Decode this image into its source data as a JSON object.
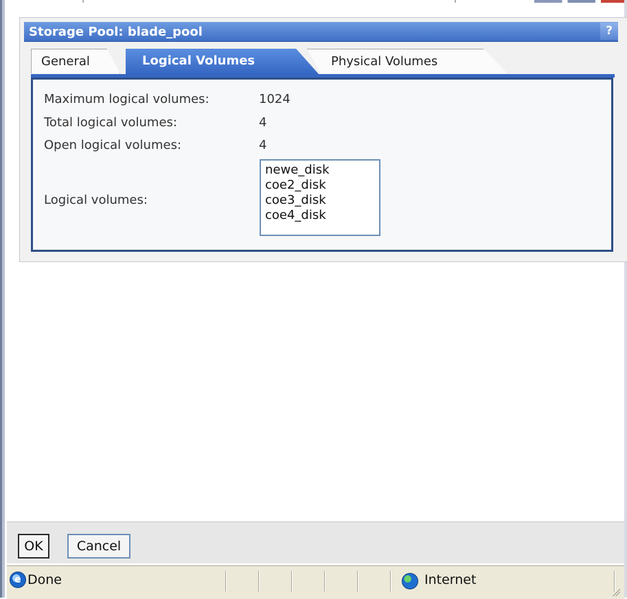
{
  "dialog": {
    "title": "Storage Pool: blade_pool",
    "help_label": "?"
  },
  "tabs": [
    {
      "label": "General"
    },
    {
      "label": "Logical Volumes"
    },
    {
      "label": "Physical Volumes"
    }
  ],
  "fields": {
    "max_label": "Maximum logical volumes:",
    "max_value": "1024",
    "total_label": "Total logical volumes:",
    "total_value": "4",
    "open_label": "Open logical volumes:",
    "open_value": "4",
    "list_label": "Logical volumes:",
    "list_items": [
      "newe_disk",
      "coe2_disk",
      "coe3_disk",
      "coe4_disk"
    ]
  },
  "buttons": {
    "ok": "OK",
    "cancel": "Cancel"
  },
  "status": {
    "done": "Done",
    "zone": "Internet"
  },
  "colors": {
    "titlebar": "#3f6fc6",
    "active_tab": "#3566c2",
    "panel_border": "#2f4f87"
  }
}
